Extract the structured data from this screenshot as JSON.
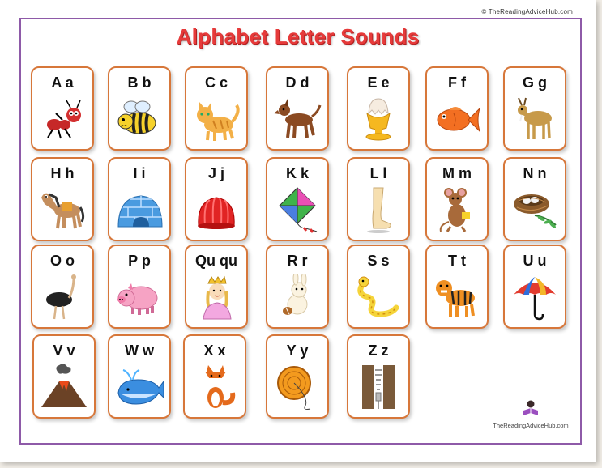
{
  "copyright": "© TheReadingAdviceHub.com",
  "title": "Alphabet Letter Sounds",
  "cards": [
    {
      "letter": "A a",
      "icon": "ant-icon"
    },
    {
      "letter": "B b",
      "icon": "bee-icon"
    },
    {
      "letter": "C c",
      "icon": "cat-icon"
    },
    {
      "letter": "D d",
      "icon": "dog-icon"
    },
    {
      "letter": "E e",
      "icon": "egg-icon"
    },
    {
      "letter": "F f",
      "icon": "fish-icon"
    },
    {
      "letter": "G g",
      "icon": "goat-icon"
    },
    {
      "letter": "H h",
      "icon": "horse-icon"
    },
    {
      "letter": "I i",
      "icon": "igloo-icon"
    },
    {
      "letter": "J j",
      "icon": "jelly-icon"
    },
    {
      "letter": "K k",
      "icon": "kite-icon"
    },
    {
      "letter": "L l",
      "icon": "leg-icon"
    },
    {
      "letter": "M m",
      "icon": "mouse-icon"
    },
    {
      "letter": "N n",
      "icon": "nest-icon"
    },
    {
      "letter": "O o",
      "icon": "ostrich-icon"
    },
    {
      "letter": "P p",
      "icon": "pig-icon"
    },
    {
      "letter": "Qu qu",
      "icon": "queen-icon"
    },
    {
      "letter": "R r",
      "icon": "rabbit-icon"
    },
    {
      "letter": "S s",
      "icon": "snake-icon"
    },
    {
      "letter": "T t",
      "icon": "tiger-icon"
    },
    {
      "letter": "U u",
      "icon": "umbrella-icon"
    },
    {
      "letter": "V v",
      "icon": "volcano-icon"
    },
    {
      "letter": "W w",
      "icon": "whale-icon"
    },
    {
      "letter": "X x",
      "icon": "fox-icon"
    },
    {
      "letter": "Y y",
      "icon": "yoyo-icon"
    },
    {
      "letter": "Z z",
      "icon": "zipper-icon"
    }
  ],
  "logo": {
    "site": "TheReadingAdviceHub.com",
    "icon": "reading-child-icon"
  }
}
